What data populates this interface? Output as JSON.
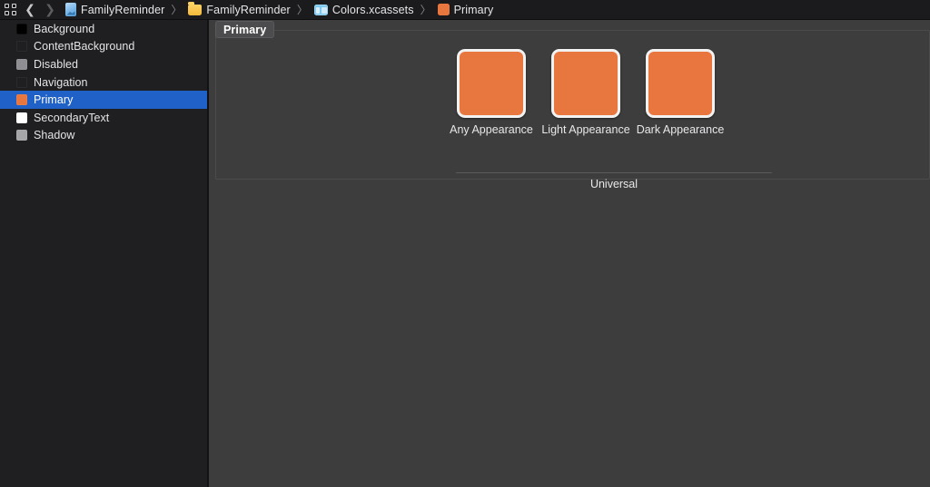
{
  "toolbar": {
    "panel_toggle_icon": "grid-icon",
    "back_icon": "chevron-left-icon",
    "forward_icon": "chevron-right-icon",
    "separator": "〉",
    "breadcrumb": [
      {
        "label": "FamilyReminder",
        "icon": "project-document-icon",
        "icon_type": "doc",
        "color": "#79b6e8"
      },
      {
        "label": "FamilyReminder",
        "icon": "folder-icon",
        "icon_type": "folder",
        "color": "#f2ba3b"
      },
      {
        "label": "Colors.xcassets",
        "icon": "asset-catalog-icon",
        "icon_type": "assets",
        "color": "#7fc8ef"
      },
      {
        "label": "Primary",
        "icon": "color-swatch-icon",
        "icon_type": "swatch",
        "color": "#e8773f"
      }
    ]
  },
  "sidebar": {
    "selected_color": "#2061c8",
    "items": [
      {
        "label": "Background",
        "swatch": "#000000",
        "selected": false
      },
      {
        "label": "ContentBackground",
        "swatch": "#1f1f21",
        "selected": false
      },
      {
        "label": "Disabled",
        "swatch": "#8e8e93",
        "selected": false
      },
      {
        "label": "Navigation",
        "swatch": "#1f1f21",
        "selected": false
      },
      {
        "label": "Primary",
        "swatch": "#e8773f",
        "selected": true
      },
      {
        "label": "SecondaryText",
        "swatch": "#ffffff",
        "selected": false
      },
      {
        "label": "Shadow",
        "swatch": "#a6a6a8",
        "selected": false
      }
    ]
  },
  "editor": {
    "tab_label": "Primary",
    "group_label": "Universal",
    "swatches": [
      {
        "caption": "Any Appearance",
        "color": "#e8773f"
      },
      {
        "caption": "Light Appearance",
        "color": "#e8773f"
      },
      {
        "caption": "Dark Appearance",
        "color": "#e8763e"
      }
    ]
  }
}
